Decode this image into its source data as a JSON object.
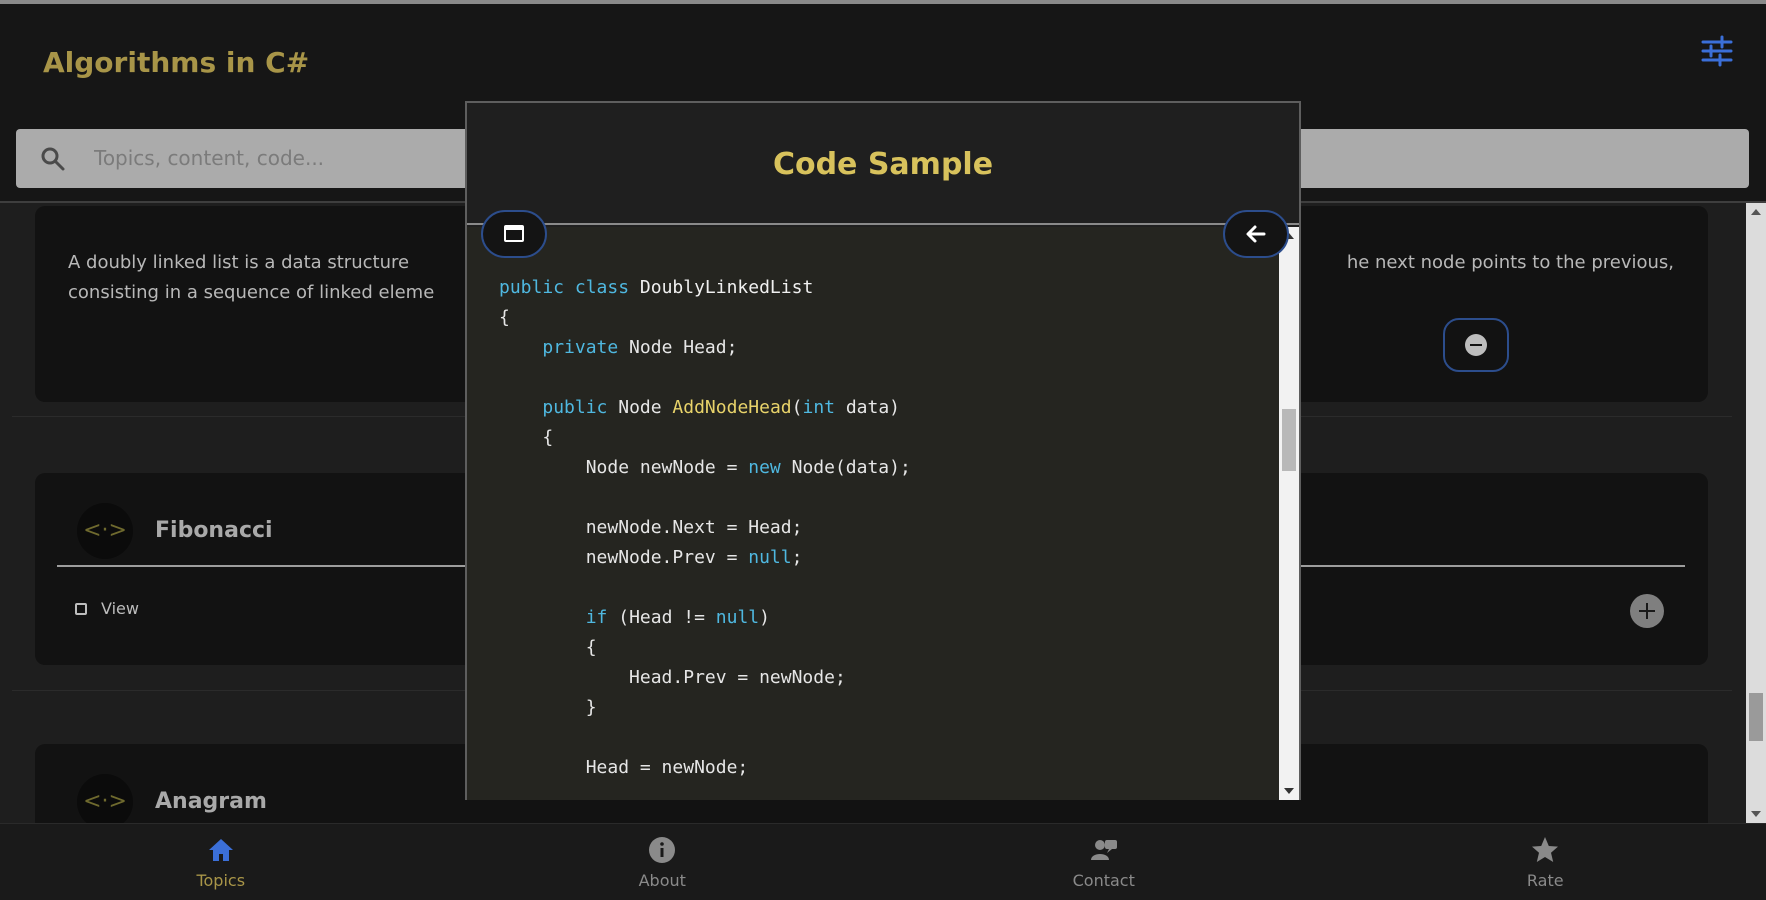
{
  "app": {
    "title": "Algorithms in C#",
    "search_placeholder": "Topics, content, code..."
  },
  "description": {
    "line1": "A doubly linked list is a data structure",
    "line1_right": "he next node points to the previous,",
    "line2": "consisting in a sequence of linked eleme"
  },
  "topics": [
    {
      "name": "Fibonacci",
      "view_label": "View"
    },
    {
      "name": "Anagram"
    }
  ],
  "modal": {
    "title": "Code Sample"
  },
  "nav": {
    "items": [
      {
        "label": "Topics",
        "icon": "home-icon",
        "active": true
      },
      {
        "label": "About",
        "icon": "info-icon",
        "active": false
      },
      {
        "label": "Contact",
        "icon": "contact-icon",
        "active": false
      },
      {
        "label": "Rate",
        "icon": "star-icon",
        "active": false
      }
    ]
  },
  "colors": {
    "accent_gold": "#a89548",
    "modal_title": "#d8c25c",
    "keyword_blue": "#4fb8e0",
    "method_yellow": "#e8d36a",
    "active_icon_blue": "#3b6fd8",
    "button_border": "#2c4d8c"
  }
}
